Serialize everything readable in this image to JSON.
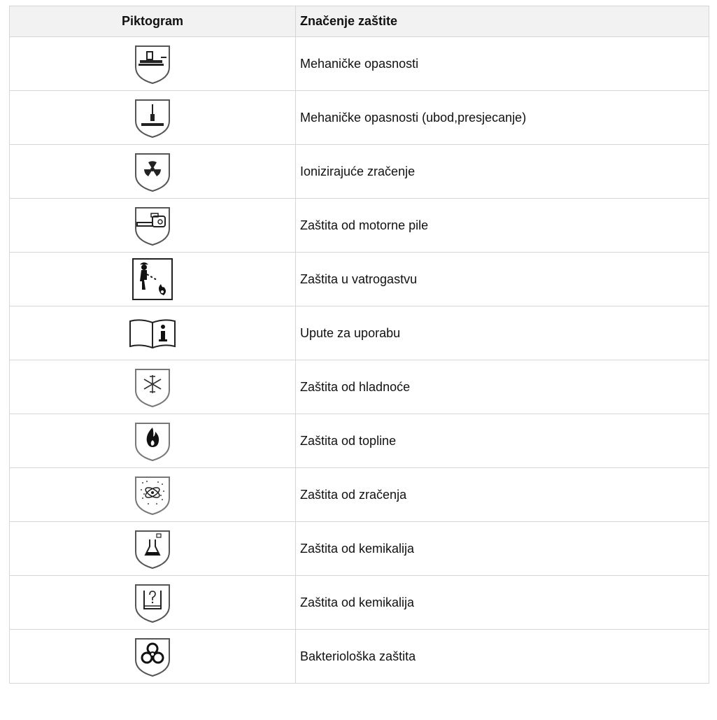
{
  "table": {
    "headers": {
      "pictogram": "Piktogram",
      "meaning": "Značenje zaštite"
    },
    "rows": [
      {
        "icon": "mechanical-hazard-icon",
        "label": "Mehaničke opasnosti"
      },
      {
        "icon": "knife-cut-icon",
        "label": "Mehaničke opasnosti (ubod,presjecanje)"
      },
      {
        "icon": "radiation-trefoil-icon",
        "label": "Ionizirajuće zračenje"
      },
      {
        "icon": "chainsaw-icon",
        "label": "Zaštita od motorne pile"
      },
      {
        "icon": "firefighter-icon",
        "label": "Zaštita u vatrogastvu"
      },
      {
        "icon": "instruction-book-icon",
        "label": "Upute za uporabu"
      },
      {
        "icon": "snowflake-icon",
        "label": "Zaštita od hladnoće"
      },
      {
        "icon": "flame-icon",
        "label": "Zaštita od topline"
      },
      {
        "icon": "contamination-radiation-icon",
        "label": "Zaštita od zračenja"
      },
      {
        "icon": "chemical-flask-icon",
        "label": "Zaštita od kemikalija"
      },
      {
        "icon": "chemical-beaker-question-icon",
        "label": "Zaštita od kemikalija"
      },
      {
        "icon": "biohazard-icon",
        "label": "Bakteriološka zaštita"
      }
    ]
  }
}
